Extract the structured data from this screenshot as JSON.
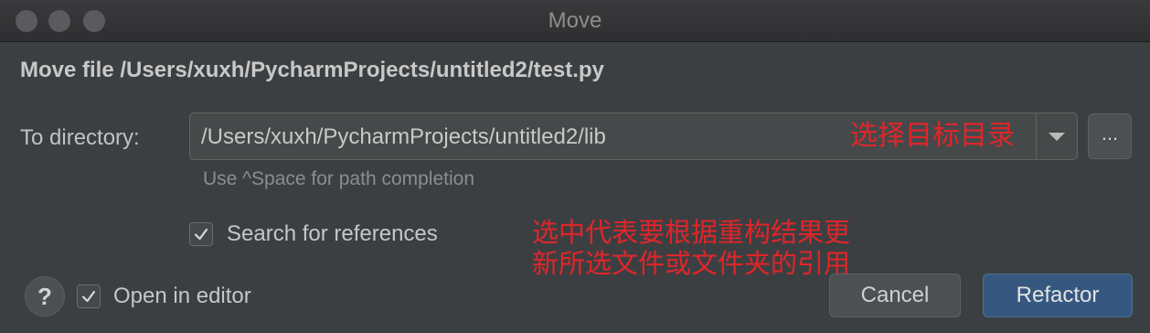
{
  "window": {
    "title": "Move"
  },
  "dialog": {
    "heading": "Move file /Users/xuxh/PycharmProjects/untitled2/test.py",
    "directory_label": "To directory:",
    "directory_value": "/Users/xuxh/PycharmProjects/untitled2/lib",
    "browse_label": "...",
    "path_hint": "Use ^Space for path completion",
    "search_references": {
      "label": "Search for references",
      "checked": true
    },
    "open_in_editor": {
      "label": "Open in editor",
      "checked": true
    },
    "help_label": "?",
    "cancel_label": "Cancel",
    "refactor_label": "Refactor"
  },
  "annotations": {
    "directory_note": "选择目标目录",
    "references_note_line1": "选中代表要根据重构结果更",
    "references_note_line2": "新所选文件或文件夹的引用"
  },
  "colors": {
    "annotation_red": "#e0252a",
    "primary_button": "#365880",
    "dialog_background": "#3c3f41"
  },
  "icons": {
    "traffic_lights": [
      "close-window-icon",
      "minimize-window-icon",
      "maximize-window-icon"
    ],
    "dropdown": "chevron-down-icon",
    "checkbox": "checkmark-icon"
  }
}
